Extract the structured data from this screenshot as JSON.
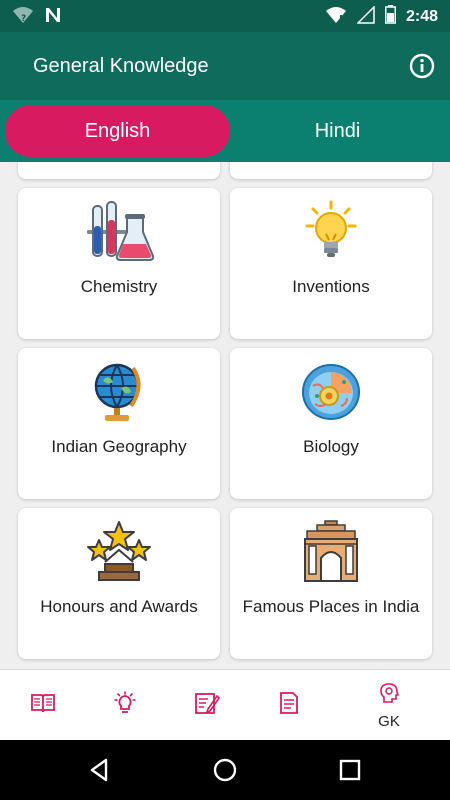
{
  "status_bar": {
    "time": "2:48",
    "icons": [
      "wifi-question-icon",
      "n-notification-icon",
      "wifi-icon",
      "signal-icon",
      "battery-icon"
    ]
  },
  "app_bar": {
    "title": "General Knowledge",
    "info_icon": "info-icon"
  },
  "tabs": [
    {
      "label": "English",
      "selected": true
    },
    {
      "label": "Hindi",
      "selected": false
    }
  ],
  "colors": {
    "status_bar": "#0d5e4f",
    "app_bar": "#0f6b5b",
    "tabs_bg": "#0c8070",
    "accent": "#d81b60",
    "nav_icon": "#d81b60"
  },
  "categories": [
    {
      "label": "Chemistry",
      "icon": "chemistry-flasks-icon"
    },
    {
      "label": "Inventions",
      "icon": "lightbulb-icon"
    },
    {
      "label": "Indian Geography",
      "icon": "globe-icon"
    },
    {
      "label": "Biology",
      "icon": "cell-icon"
    },
    {
      "label": "Honours and Awards",
      "icon": "stars-trophy-icon"
    },
    {
      "label": "Famous Places in India",
      "icon": "india-gate-icon"
    }
  ],
  "bottom_nav": [
    {
      "icon": "book-icon",
      "label": ""
    },
    {
      "icon": "lightbulb-nav-icon",
      "label": ""
    },
    {
      "icon": "edit-icon",
      "label": ""
    },
    {
      "icon": "document-icon",
      "label": ""
    },
    {
      "icon": "head-bulb-icon",
      "label": "GK"
    }
  ],
  "system_nav": [
    "back-icon",
    "home-icon",
    "recents-icon"
  ]
}
